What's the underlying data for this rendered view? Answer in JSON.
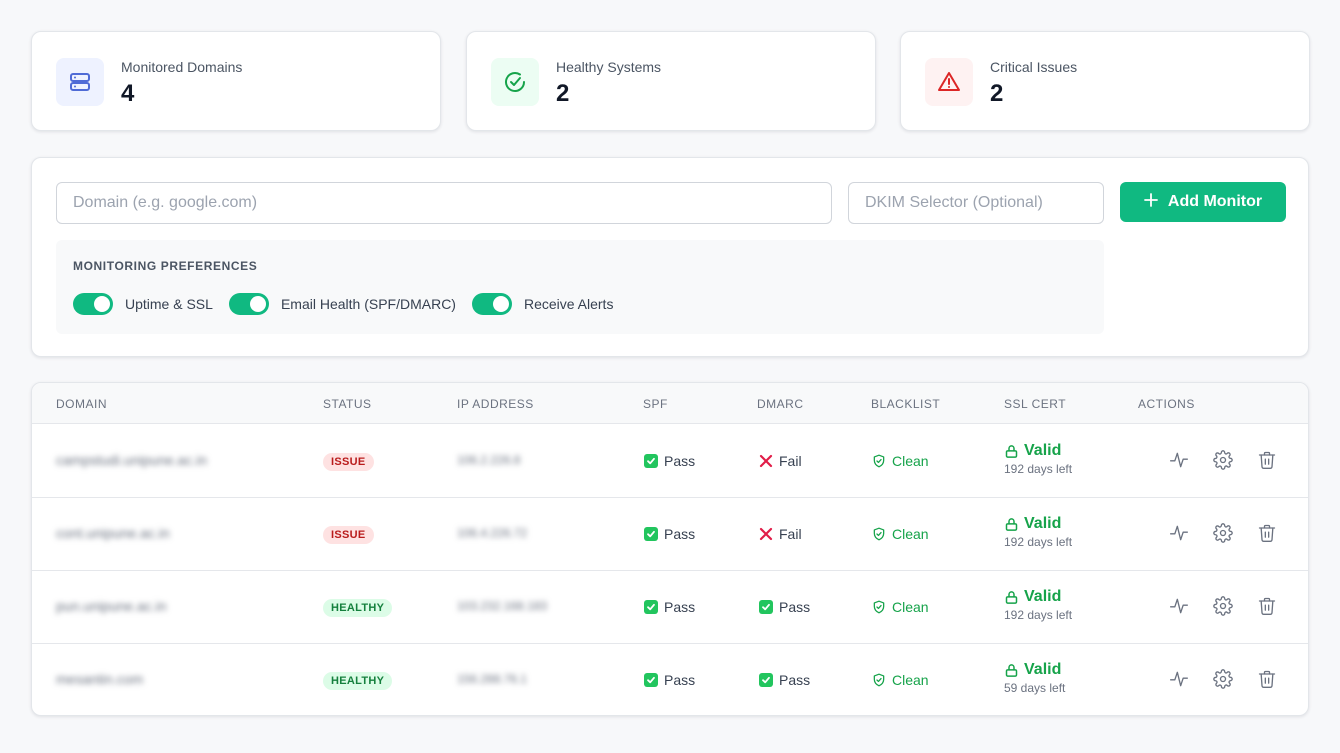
{
  "stats": [
    {
      "label": "Monitored Domains",
      "value": "4",
      "icon": "server-icon",
      "bg": "#eef2ff",
      "color": "#4f6bd6"
    },
    {
      "label": "Healthy Systems",
      "value": "2",
      "icon": "check-circle-icon",
      "bg": "#ecfdf3",
      "color": "#16a34a"
    },
    {
      "label": "Critical Issues",
      "value": "2",
      "icon": "warning-triangle-icon",
      "bg": "#fef2f2",
      "color": "#dc2626"
    }
  ],
  "form": {
    "domain_placeholder": "Domain (e.g. google.com)",
    "dkim_placeholder": "DKIM Selector (Optional)",
    "add_label": "Add Monitor",
    "prefs_title": "MONITORING PREFERENCES",
    "toggles": [
      {
        "label": "Uptime & SSL",
        "on": true
      },
      {
        "label": "Email Health (SPF/DMARC)",
        "on": true
      },
      {
        "label": "Receive Alerts",
        "on": true
      }
    ]
  },
  "table": {
    "headers": [
      "DOMAIN",
      "STATUS",
      "IP ADDRESS",
      "SPF",
      "DMARC",
      "BLACKLIST",
      "SSL CERT",
      "ACTIONS"
    ],
    "rows": [
      {
        "domain": "campstudi.unipune.ac.in",
        "status": "ISSUE",
        "ip": "106.2.226.8",
        "spf": "Pass",
        "dmarc": "Fail",
        "blacklist": "Clean",
        "ssl": "Valid",
        "ssl_days": "192 days left"
      },
      {
        "domain": "cont.unipune.ac.in",
        "status": "ISSUE",
        "ip": "106.4.226.72",
        "spf": "Pass",
        "dmarc": "Fail",
        "blacklist": "Clean",
        "ssl": "Valid",
        "ssl_days": "192 days left"
      },
      {
        "domain": "pun.unipune.ac.in",
        "status": "HEALTHY",
        "ip": "103.232.168.183",
        "spf": "Pass",
        "dmarc": "Pass",
        "blacklist": "Clean",
        "ssl": "Valid",
        "ssl_days": "192 days left"
      },
      {
        "domain": "mesantin.com",
        "status": "HEALTHY",
        "ip": "156.288.76.1",
        "spf": "Pass",
        "dmarc": "Pass",
        "blacklist": "Clean",
        "ssl": "Valid",
        "ssl_days": "59 days left"
      }
    ]
  },
  "colors": {
    "accent": "#10b981",
    "issue": "#b91c1c",
    "healthy": "#15803d"
  }
}
